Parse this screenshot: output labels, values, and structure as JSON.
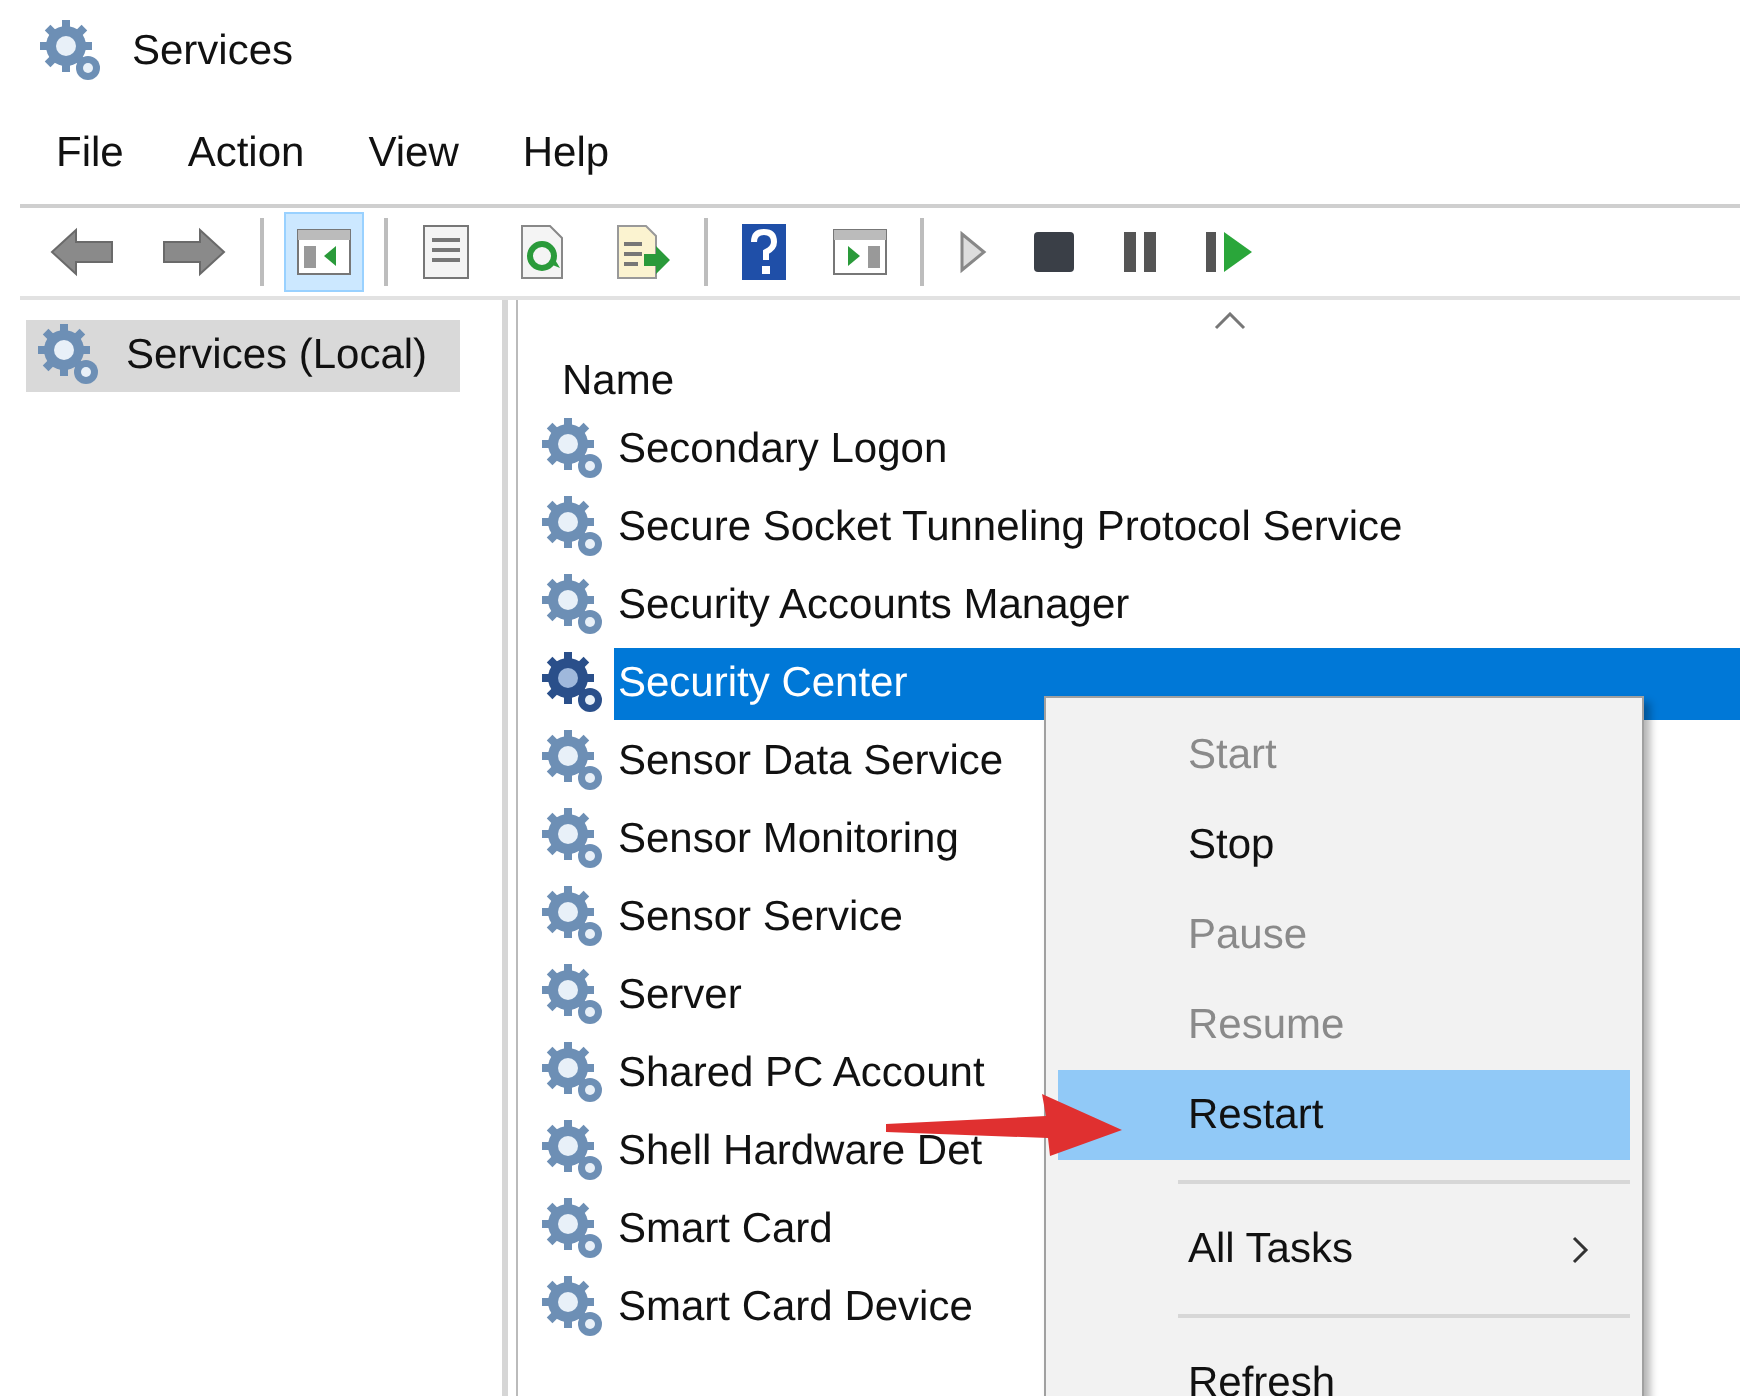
{
  "window": {
    "title": "Services"
  },
  "menu_bar": [
    "File",
    "Action",
    "View",
    "Help"
  ],
  "toolbar": [
    {
      "kind": "back",
      "pressed": false
    },
    {
      "kind": "forward",
      "pressed": false
    },
    {
      "kind": "separator"
    },
    {
      "kind": "console-tree",
      "pressed": true
    },
    {
      "kind": "separator"
    },
    {
      "kind": "properties",
      "pressed": false
    },
    {
      "kind": "refresh",
      "pressed": false
    },
    {
      "kind": "export",
      "pressed": false
    },
    {
      "kind": "separator"
    },
    {
      "kind": "help",
      "pressed": false
    },
    {
      "kind": "action-pane",
      "pressed": false
    },
    {
      "kind": "separator"
    },
    {
      "kind": "play",
      "pressed": false
    },
    {
      "kind": "stop",
      "pressed": false
    },
    {
      "kind": "pause",
      "pressed": false
    },
    {
      "kind": "resume",
      "pressed": false
    }
  ],
  "tree": {
    "items": [
      {
        "label": "Services (Local)",
        "selected": true
      }
    ]
  },
  "list": {
    "columns": [
      "Name"
    ],
    "rows": [
      {
        "name": "Secondary Logon",
        "selected": false
      },
      {
        "name": "Secure Socket Tunneling Protocol Service",
        "selected": false
      },
      {
        "name": "Security Accounts Manager",
        "selected": false
      },
      {
        "name": "Security Center",
        "selected": true
      },
      {
        "name": "Sensor Data Service",
        "selected": false
      },
      {
        "name": "Sensor Monitoring",
        "selected": false
      },
      {
        "name": "Sensor Service",
        "selected": false
      },
      {
        "name": "Server",
        "selected": false
      },
      {
        "name": "Shared PC Account",
        "selected": false
      },
      {
        "name": "Shell Hardware Det",
        "selected": false
      },
      {
        "name": "Smart Card",
        "selected": false
      },
      {
        "name": "Smart Card Device",
        "selected": false
      }
    ]
  },
  "context_menu": {
    "items": [
      {
        "kind": "item",
        "label": "Start",
        "disabled": true,
        "selected": false
      },
      {
        "kind": "item",
        "label": "Stop",
        "disabled": false,
        "selected": false
      },
      {
        "kind": "item",
        "label": "Pause",
        "disabled": true,
        "selected": false
      },
      {
        "kind": "item",
        "label": "Resume",
        "disabled": true,
        "selected": false
      },
      {
        "kind": "item",
        "label": "Restart",
        "disabled": false,
        "selected": true
      },
      {
        "kind": "separator"
      },
      {
        "kind": "submenu",
        "label": "All Tasks",
        "disabled": false,
        "selected": false
      },
      {
        "kind": "separator"
      },
      {
        "kind": "item",
        "label": "Refresh",
        "disabled": false,
        "selected": false
      }
    ]
  }
}
